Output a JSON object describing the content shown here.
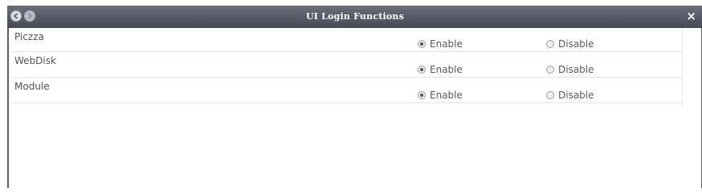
{
  "window": {
    "title": "UI Login Functions",
    "close_label": "×"
  },
  "functions": [
    {
      "name": "Piczza",
      "enable_label": "Enable",
      "disable_label": "Disable",
      "selected": "Enable"
    },
    {
      "name": "WebDisk",
      "enable_label": "Enable",
      "disable_label": "Disable",
      "selected": "Enable"
    },
    {
      "name": "Module",
      "enable_label": "Enable",
      "disable_label": "Disable",
      "selected": "Enable"
    }
  ]
}
